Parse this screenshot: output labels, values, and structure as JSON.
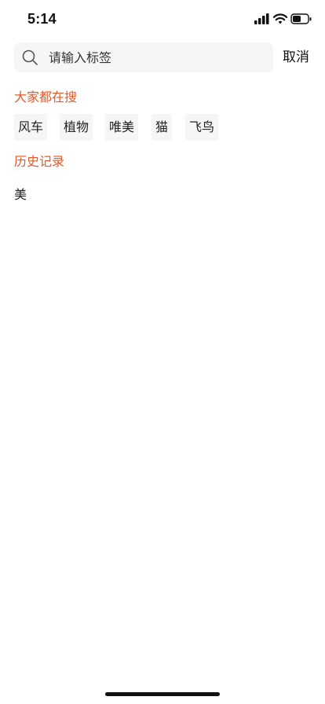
{
  "status_bar": {
    "time": "5:14",
    "icons": [
      "signal-icon",
      "wifi-icon",
      "battery-icon"
    ]
  },
  "search": {
    "placeholder": "请输入标签",
    "value": "",
    "icon": "search-icon",
    "cancel_label": "取消"
  },
  "hot": {
    "title": "大家都在搜",
    "tags": [
      "风车",
      "植物",
      "唯美",
      "猫",
      "飞鸟"
    ]
  },
  "history": {
    "title": "历史记录",
    "items": [
      "美"
    ]
  },
  "colors": {
    "accent": "#e2592a",
    "search_bg": "#f6f6f6",
    "tag_bg": "#f6f6f6",
    "text": "#111111"
  }
}
